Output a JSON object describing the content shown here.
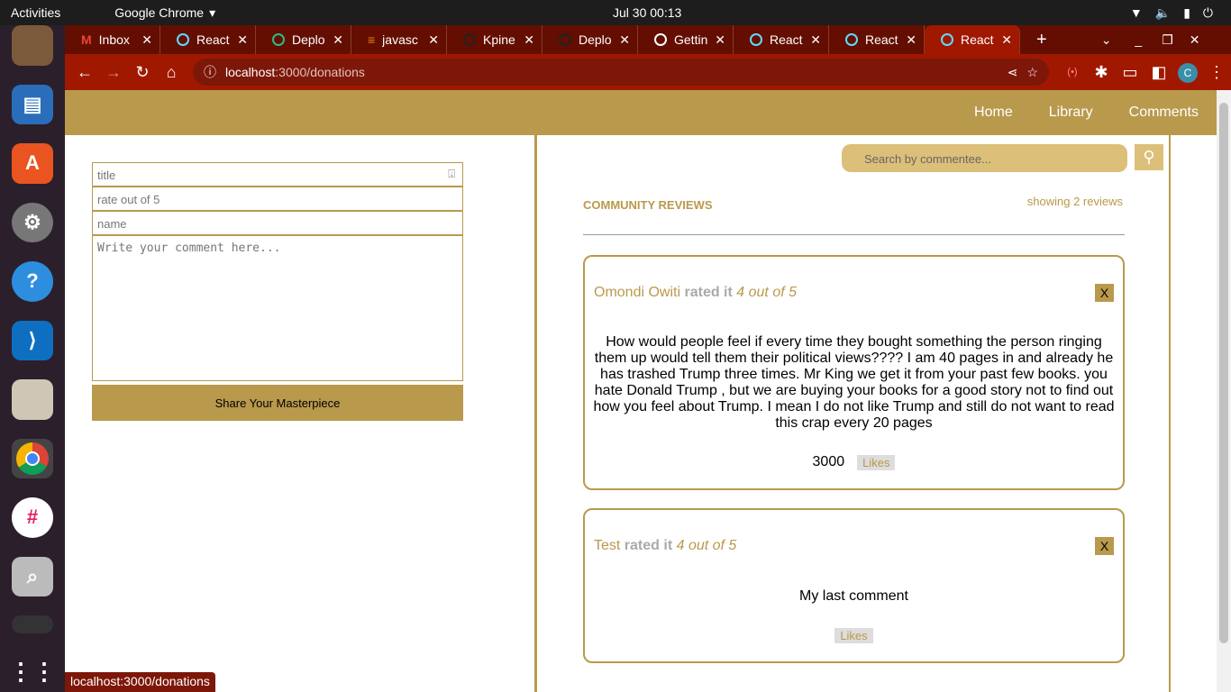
{
  "os": {
    "activities": "Activities",
    "app": "Google Chrome",
    "clock": "Jul 30  00:13"
  },
  "tabs": [
    "Inbox",
    "React",
    "Deplo",
    "javasc",
    "Kpine",
    "Deplo",
    "Gettin",
    "React",
    "React",
    "React"
  ],
  "url": {
    "host": "localhost",
    "path": ":3000/donations"
  },
  "nav": {
    "items": [
      "Home",
      "Library",
      "Comments"
    ]
  },
  "form": {
    "title_ph": "title",
    "rate_ph": "rate out of 5",
    "name_ph": "name",
    "comment_ph": "Write your comment here...",
    "submit": "Share Your Masterpiece"
  },
  "search": {
    "placeholder": "Search by commentee..."
  },
  "reviews": {
    "heading": "COMMUNITY REVIEWS",
    "count": "showing 2 reviews",
    "rated": "rated it",
    "likes_label": "Likes",
    "close": "X",
    "items": [
      {
        "name": "Omondi Owiti",
        "rating": "4 out of 5",
        "body": "How would people feel if every time they bought something the person ringing them up would tell them their political views???? I am 40 pages in and already he has trashed Trump three times. Mr King we get it from your past few books. you hate Donald Trump , but we are buying your books for a good story not to find out how you feel about Trump. I mean I do not like Trump and still do not want to read this crap every 20 pages",
        "likes": "3000"
      },
      {
        "name": "Test",
        "rating": "4 out of 5",
        "body": "My last comment",
        "likes": ""
      }
    ]
  },
  "status": "localhost:3000/donations",
  "colors": {
    "accent": "#b9994c",
    "chrome": "#a11800"
  }
}
